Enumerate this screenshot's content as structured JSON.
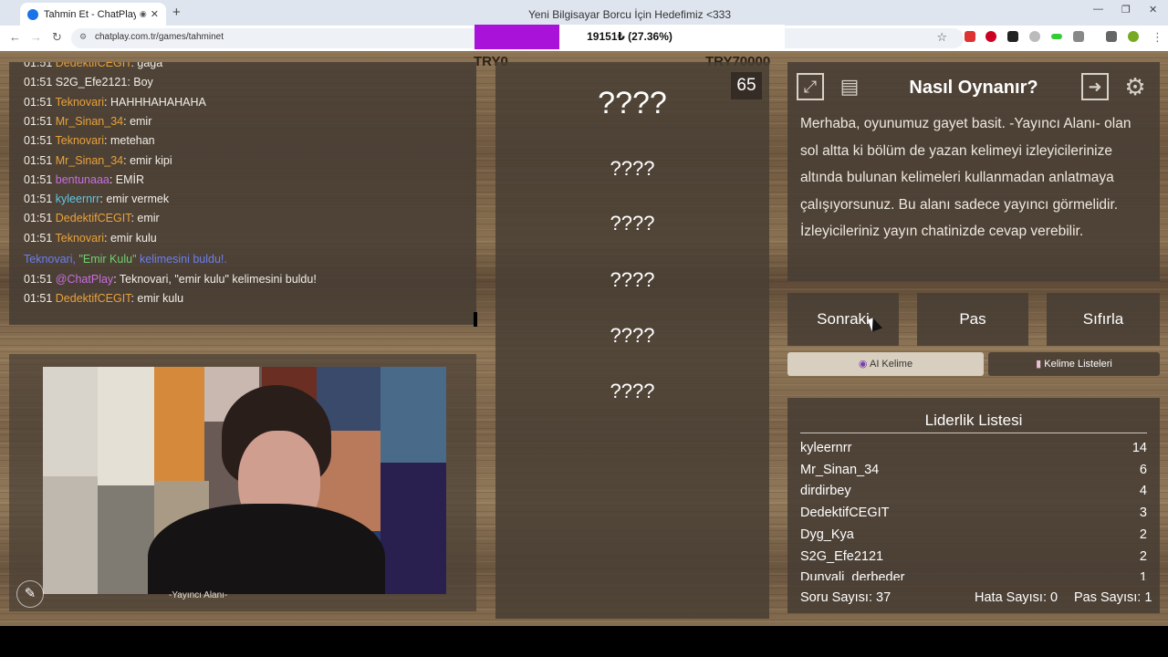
{
  "browser": {
    "tab_title": "Tahmin Et - ChatPlay",
    "url": "chatplay.com.tr/games/tahminet",
    "new_tab": "+",
    "close_tab": "✕"
  },
  "goal": {
    "title": "Yeni Bilgisayar Borcu İçin Hedefimiz <333",
    "progress_text": "19151₺ (27.36%)",
    "progress_fraction": 0.2736,
    "color": "#a912d9"
  },
  "chat": {
    "messages": [
      {
        "time": "01:51",
        "user": "DedektifCEGIT",
        "text": ": gaga",
        "color": "#e8a23a"
      },
      {
        "time": "01:51",
        "user": "S2G_Efe2121",
        "text": ": Boy",
        "color": "#f2efe9"
      },
      {
        "time": "01:51",
        "user": "Teknovari",
        "text": ": HAHHHAHAHAHA",
        "color": "#e8a23a"
      },
      {
        "time": "01:51",
        "user": "Mr_Sinan_34",
        "text": ": emir",
        "color": "#e8a23a"
      },
      {
        "time": "01:51",
        "user": "Teknovari",
        "text": ": metehan",
        "color": "#e8a23a"
      },
      {
        "time": "01:51",
        "user": "Mr_Sinan_34",
        "text": ": emir kipi",
        "color": "#e8a23a"
      },
      {
        "time": "01:51",
        "user": "bentunaaa",
        "text": ": EMİR",
        "color": "#c86ee0"
      },
      {
        "time": "01:51",
        "user": "kyleernrr",
        "text": ": emir vermek",
        "color": "#5ec8e8"
      },
      {
        "time": "01:51",
        "user": "DedektifCEGIT",
        "text": ": emir",
        "color": "#e8a23a"
      },
      {
        "time": "01:51",
        "user": "Teknovari",
        "text": ": emir kulu",
        "color": "#e8a23a"
      }
    ],
    "system_prefix": "Teknovari, ",
    "system_word": "\"Emir Kulu\"",
    "system_suffix": " kelimesini buldu!.",
    "bot_time": "01:51",
    "bot_user": "@ChatPlay",
    "bot_text": ": Teknovari, \"emir kulu\" kelimesini buldu!",
    "last_time": "01:51",
    "last_user": "DedektifCEGIT",
    "last_text": ": emir kulu"
  },
  "stream": {
    "label": "-Yayıncı Alanı-",
    "tool_icon": "pencil-icon"
  },
  "words": {
    "try_left": "TRY0",
    "try_right": "TRY70000",
    "timer": "65",
    "items": [
      "????",
      "????",
      "????",
      "????",
      "????",
      "????"
    ]
  },
  "how": {
    "title": "Nasıl Oynanır?",
    "text": "Merhaba, oyunumuz gayet basit. -Yayıncı Alanı- olan sol altta ki bölüm de yazan kelimeyi izleyicilerinize altında bulunan kelimeleri kullanmadan anlatmaya çalışıyorsunuz. Bu alanı sadece yayıncı görmelidir. İzleyicileriniz yayın chatinizde cevap verebilir."
  },
  "buttons": {
    "next": "Sonraki",
    "pass": "Pas",
    "reset": "Sıfırla",
    "ai_word": "AI Kelime",
    "word_lists": "Kelime Listeleri"
  },
  "leaderboard": {
    "title": "Liderlik Listesi",
    "rows": [
      {
        "name": "kyleernrr",
        "score": "14"
      },
      {
        "name": "Mr_Sinan_34",
        "score": "6"
      },
      {
        "name": "dirdirbey",
        "score": "4"
      },
      {
        "name": "DedektifCEGIT",
        "score": "3"
      },
      {
        "name": "Dyg_Kya",
        "score": "2"
      },
      {
        "name": "S2G_Efe2121",
        "score": "2"
      },
      {
        "name": "Dunyali_derbeder",
        "score": "1"
      }
    ]
  },
  "stats": {
    "questions": "Soru Sayısı: 37",
    "errors": "Hata Sayısı: 0",
    "passes": "Pas Sayısı: 1"
  }
}
